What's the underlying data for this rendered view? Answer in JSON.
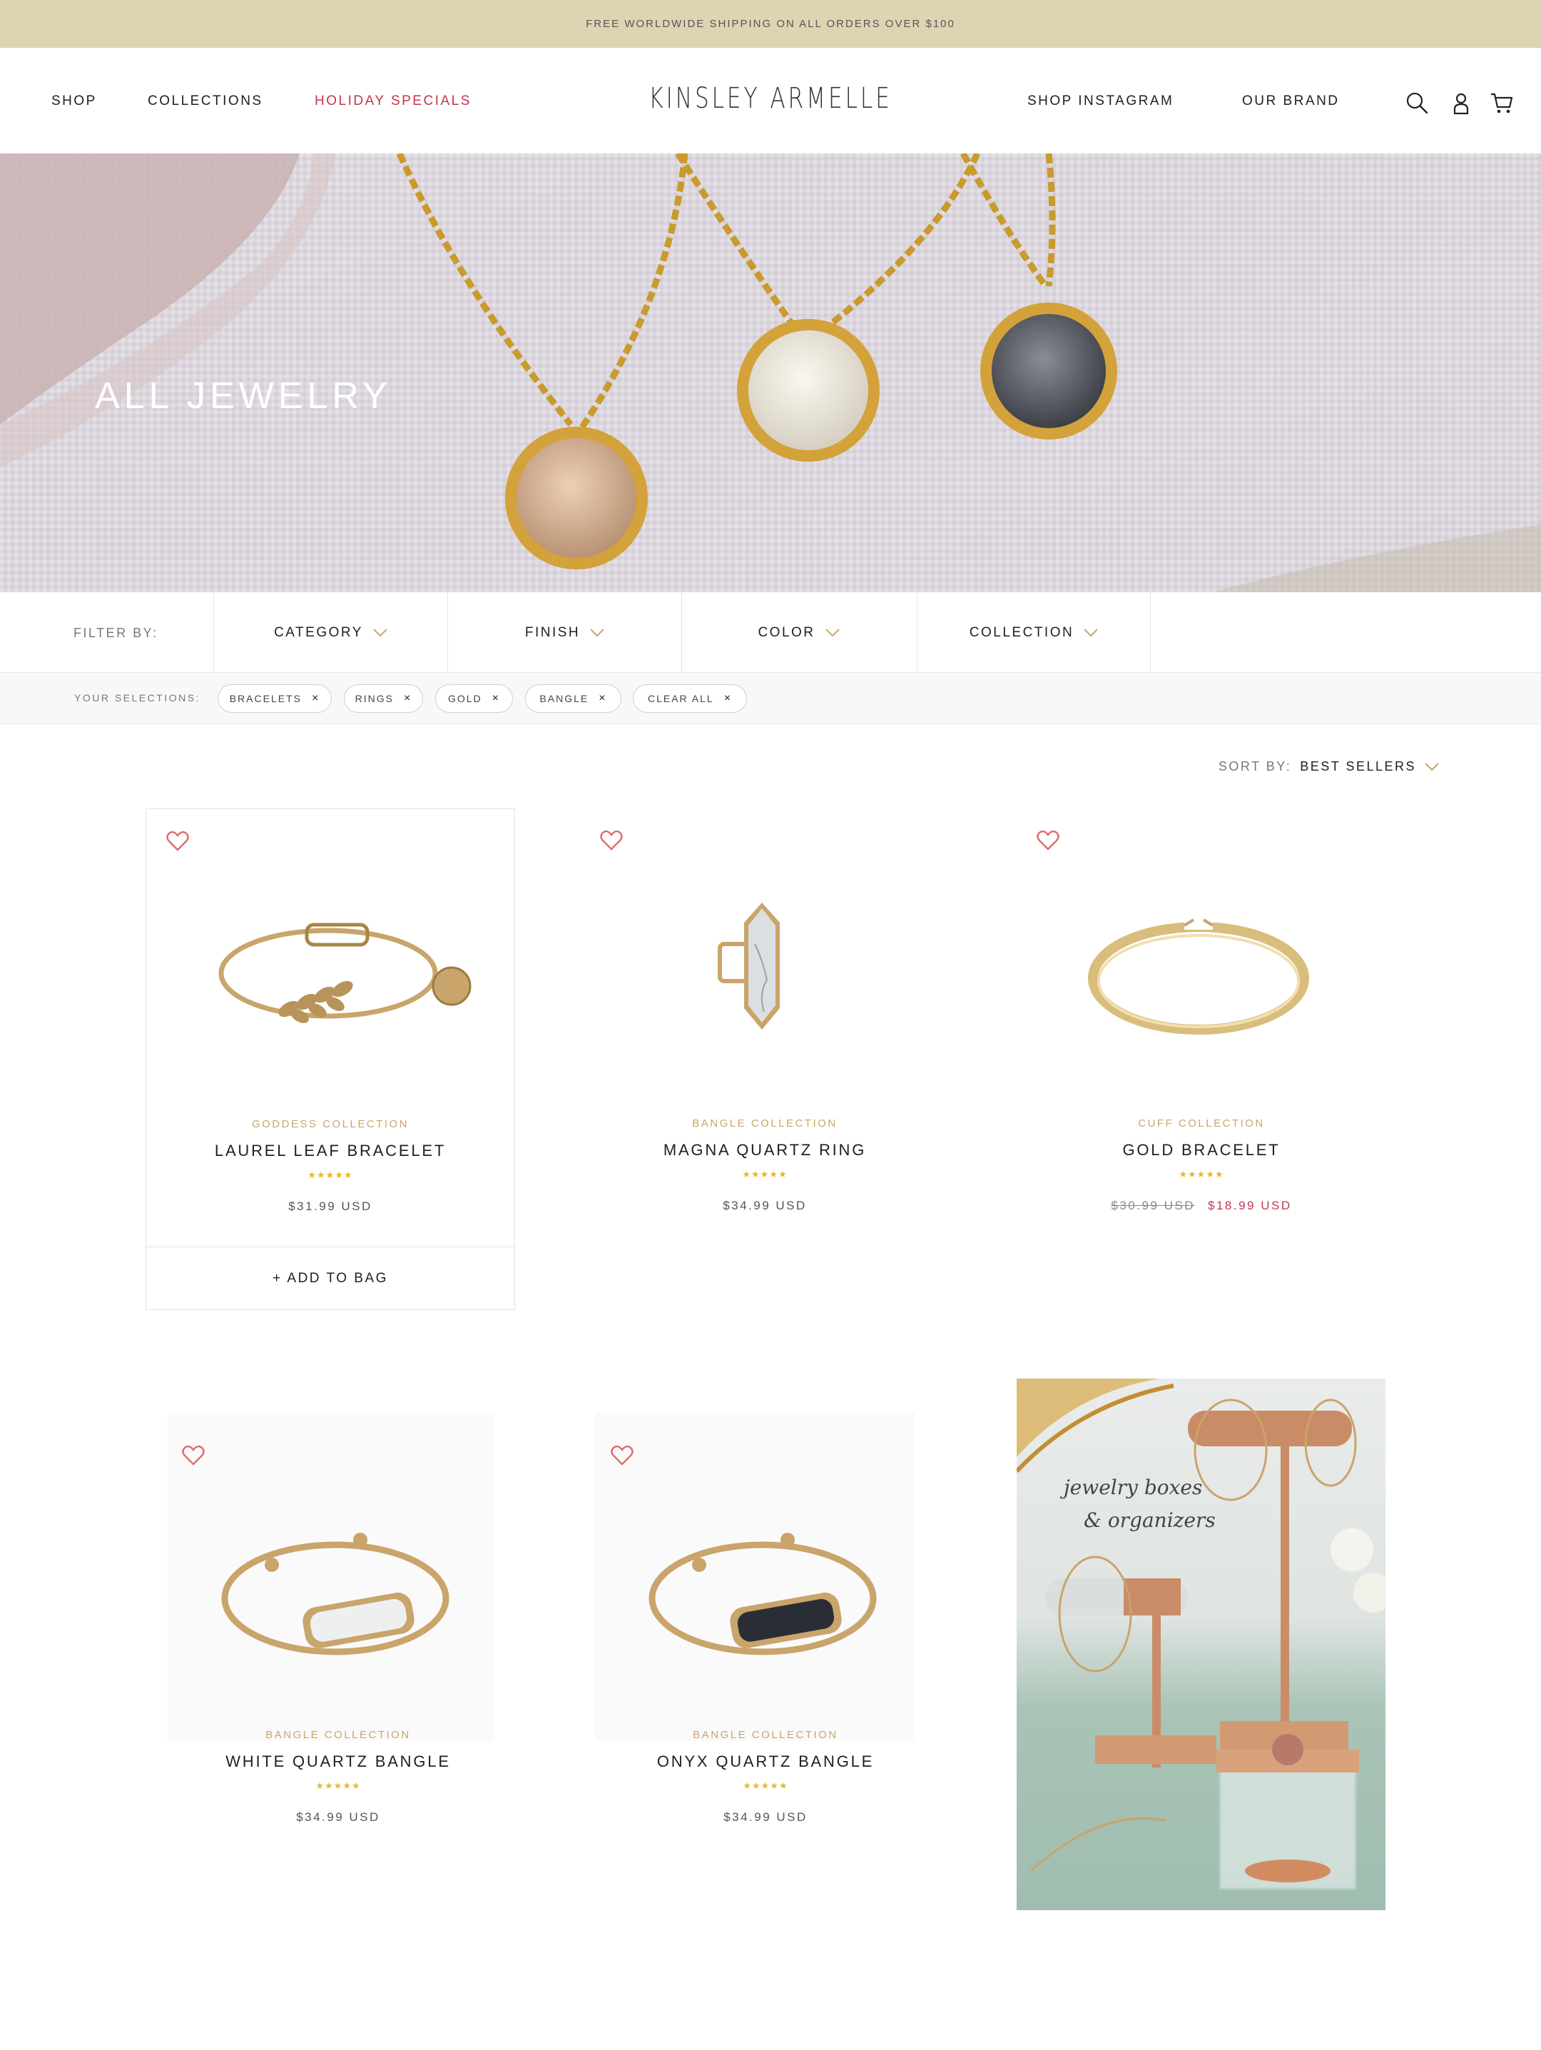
{
  "announcement": "FREE WORLDWIDE SHIPPING ON ALL ORDERS OVER $100",
  "nav": {
    "shop": "SHOP",
    "collections": "COLLECTIONS",
    "holiday": "HOLIDAY SPECIALS",
    "instagram": "SHOP INSTAGRAM",
    "brand": "OUR BRAND"
  },
  "logo": "KINSLEY ARMELLE",
  "header_icons": [
    "search-icon",
    "account-icon",
    "cart-icon"
  ],
  "hero": {
    "title": "ALL JEWELRY"
  },
  "filters": {
    "label": "FILTER BY:",
    "items": [
      "CATEGORY",
      "FINISH",
      "COLOR",
      "COLLECTION"
    ]
  },
  "selections": {
    "label": "YOUR SELECTIONS:",
    "chips": [
      "BRACELETS",
      "RINGS",
      "GOLD",
      "BANGLE",
      "CLEAR ALL"
    ]
  },
  "sort": {
    "label": "SORT BY:",
    "value": "BEST SELLERS"
  },
  "products": [
    {
      "collection": "GODDESS COLLECTION",
      "name": "LAUREL LEAF BRACELET",
      "stars": "★★★★★",
      "price": "$31.99 USD",
      "add_to_bag": "+ ADD TO BAG"
    },
    {
      "collection": "BANGLE COLLECTION",
      "name": "MAGNA QUARTZ RING",
      "stars": "★★★★★",
      "price": "$34.99 USD"
    },
    {
      "collection": "CUFF COLLECTION",
      "name": "GOLD BRACELET",
      "stars": "★★★★★",
      "old_price": "$30.99 USD",
      "sale_price": "$18.99 USD"
    },
    {
      "collection": "BANGLE COLLECTION",
      "name": "WHITE QUARTZ BANGLE",
      "stars": "★★★★★",
      "price": "$34.99 USD"
    },
    {
      "collection": "BANGLE COLLECTION",
      "name": "ONYX QUARTZ BANGLE",
      "stars": "★★★★★",
      "price": "$34.99 USD"
    }
  ],
  "promo": {
    "line1": "jewelry boxes",
    "line2": "& organizers"
  },
  "colors": {
    "accent": "#c2364f",
    "gold": "#c9a56a",
    "announce_bg": "#ded4b3",
    "stars": "#e9b827"
  }
}
